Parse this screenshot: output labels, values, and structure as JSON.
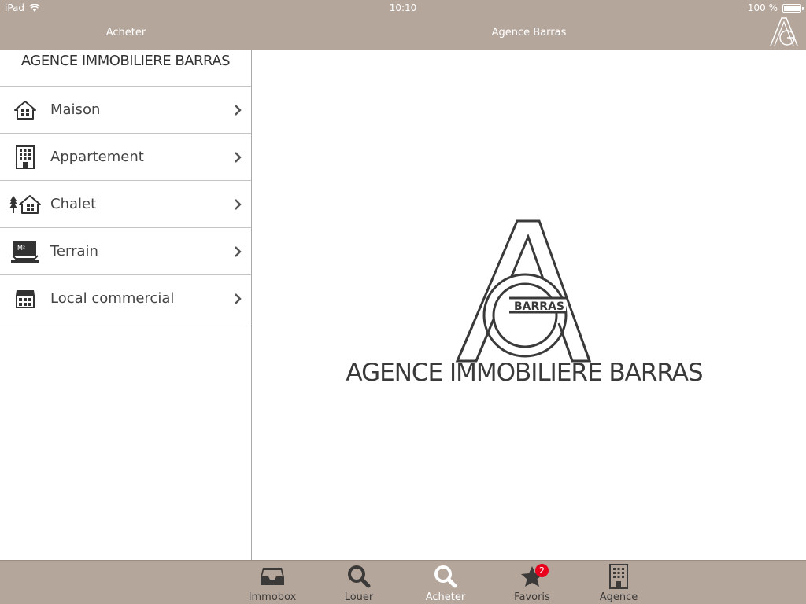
{
  "status_bar": {
    "device": "iPad",
    "time": "10:10",
    "battery": "100 %"
  },
  "nav": {
    "left_title": "Acheter",
    "main_title": "Agence Barras",
    "logo_icon": "agency-monogram-icon"
  },
  "sidebar": {
    "header": "AGENCE IMMOBILIERE BARRAS",
    "items": [
      {
        "label": "Maison",
        "icon": "house-icon"
      },
      {
        "label": "Appartement",
        "icon": "apartment-building-icon"
      },
      {
        "label": "Chalet",
        "icon": "chalet-icon"
      },
      {
        "label": "Terrain",
        "icon": "land-plot-icon"
      },
      {
        "label": "Local commercial",
        "icon": "shop-icon"
      }
    ]
  },
  "main": {
    "logo_text": "BARRAS",
    "brand": "AGENCE IMMOBILIERE BARRAS"
  },
  "tabbar": {
    "tabs": [
      {
        "label": "Immobox",
        "icon": "inbox-icon",
        "active": false
      },
      {
        "label": "Louer",
        "icon": "search-icon",
        "active": false
      },
      {
        "label": "Acheter",
        "icon": "search-icon",
        "active": true
      },
      {
        "label": "Favoris",
        "icon": "star-icon",
        "active": false,
        "badge": "2"
      },
      {
        "label": "Agence",
        "icon": "building-icon",
        "active": false
      }
    ]
  },
  "colors": {
    "bar": "#b5a69c",
    "badge": "#e8001c"
  }
}
